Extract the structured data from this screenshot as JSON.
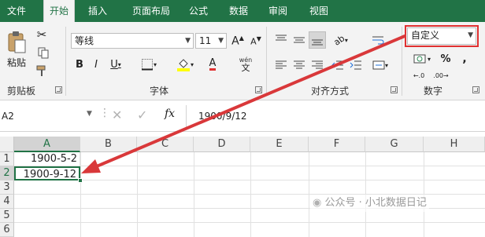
{
  "menu": {
    "tabs": [
      {
        "label": "文件"
      },
      {
        "label": "开始"
      },
      {
        "label": "插入"
      },
      {
        "label": "页面布局"
      },
      {
        "label": "公式"
      },
      {
        "label": "数据"
      },
      {
        "label": "审阅"
      },
      {
        "label": "视图"
      }
    ],
    "active_index": 1
  },
  "ribbon": {
    "clipboard": {
      "paste_label": "粘贴",
      "group_label": "剪贴板"
    },
    "font": {
      "font_name": "等线",
      "font_size": "11",
      "group_label": "字体",
      "phonetic_label": "wén"
    },
    "alignment": {
      "group_label": "对齐方式"
    },
    "number": {
      "format_value": "自定义",
      "group_label": "数字"
    }
  },
  "formula_bar": {
    "name_box": "A2",
    "fx_label": "fx",
    "content": "1900/9/12"
  },
  "sheet": {
    "columns": [
      "A",
      "B",
      "C",
      "D",
      "E",
      "F",
      "G",
      "H"
    ],
    "rows": [
      "1",
      "2",
      "3",
      "4",
      "5",
      "6"
    ],
    "cells": {
      "A1": "1900-5-2",
      "A2": "1900-9-12"
    },
    "selected": "A2"
  },
  "watermark": {
    "text": "公众号 · 小北数据日记"
  },
  "colors": {
    "excel_green": "#217346",
    "highlight_red": "#e03131",
    "arrow_red": "#d9383a"
  }
}
